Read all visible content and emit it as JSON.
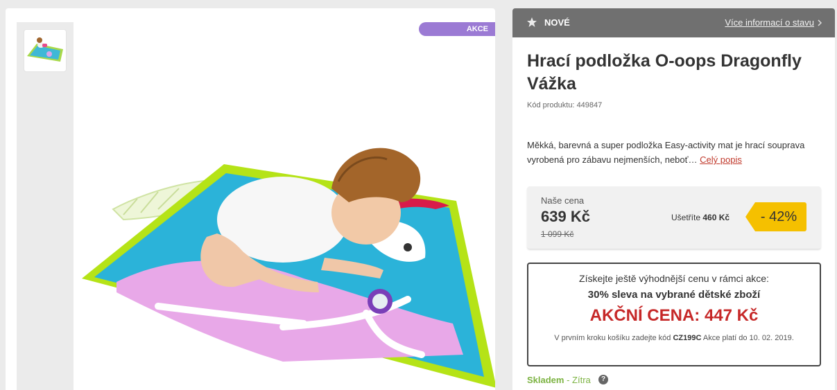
{
  "gallery": {
    "badge": "AKCE",
    "thumbnail_alt": "product-thumbnail",
    "image_alt": "baby-on-play-mat"
  },
  "status": {
    "label": "NOVÉ",
    "link": "Více informací o stavu"
  },
  "product": {
    "title": "Hrací podložka O-oops Dragonfly Vážka",
    "code_label": "Kód produktu:",
    "code_value": "449847",
    "description": "Měkká, barevná a super podložka Easy-activity mat je hrací souprava vyrobená pro zábavu nejmenších, neboť…",
    "description_link": "Celý popis"
  },
  "price": {
    "label": "Naše cena",
    "current": "639 Kč",
    "old": "1 099 Kč",
    "save_label": "Ušetříte",
    "save_value": "460 Kč",
    "discount": "- 42%"
  },
  "promo": {
    "line1": "Získejte ještě výhodnější cenu v rámci akce:",
    "line2": "30% sleva na vybrané dětské zboží",
    "action_price": "AKČNÍ CENA: 447 Kč",
    "note_pre": "V prvním kroku košíku zadejte kód",
    "note_code": "CZ199C",
    "note_post": "Akce platí do 10. 02. 2019."
  },
  "stock": {
    "status": "Skladem",
    "separator": " - ",
    "when": "Zítra",
    "help": "?"
  },
  "colors": {
    "badge_purple": "#9b7ad4",
    "status_bar": "#707070",
    "discount_yellow": "#f5c000",
    "action_red": "#c62828",
    "stock_green": "#7cb342"
  }
}
